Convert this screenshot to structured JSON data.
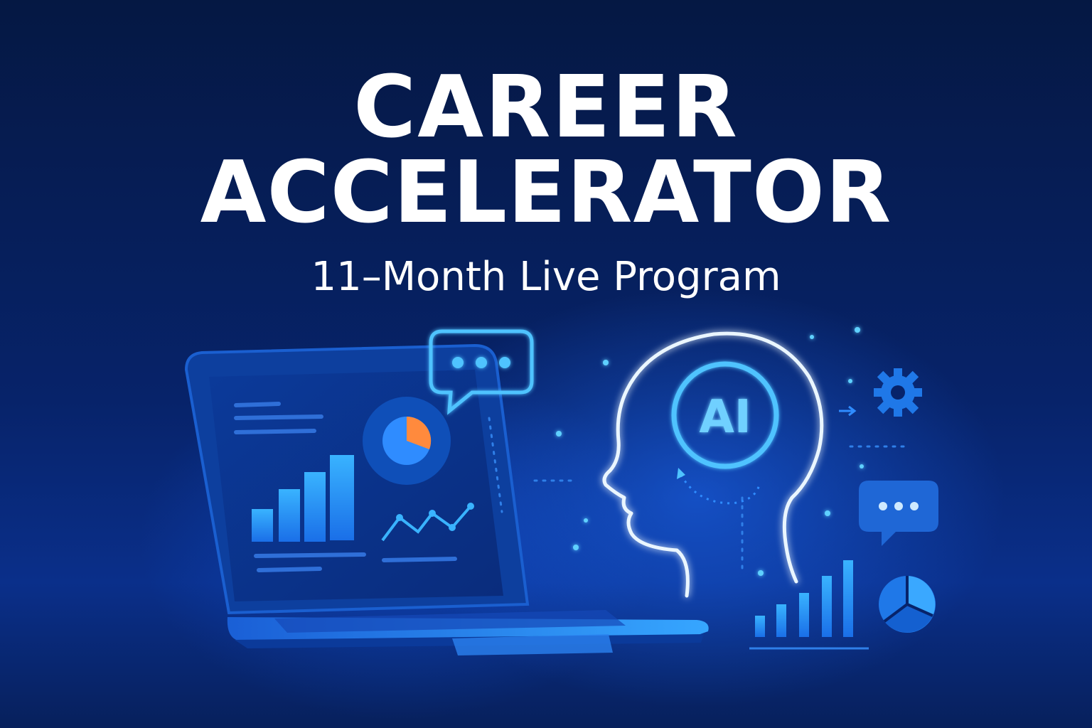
{
  "title": {
    "line1": "CAREER",
    "line2": "ACCELERATOR"
  },
  "subtitle": "11–Month Live Program",
  "illustration": {
    "head_label": "AI",
    "icons": [
      "laptop-icon",
      "chat-bubble-icon",
      "ai-head-icon",
      "gear-icon",
      "arrow-icon",
      "bar-chart-icon",
      "pie-chart-icon",
      "line-chart-icon"
    ]
  },
  "colors": {
    "background_top": "#051843",
    "background_bottom": "#0a2f8a",
    "accent_blue": "#2f8cff",
    "glow_blue": "#4fc3ff",
    "accent_orange": "#ff8a3d",
    "text": "#ffffff"
  }
}
